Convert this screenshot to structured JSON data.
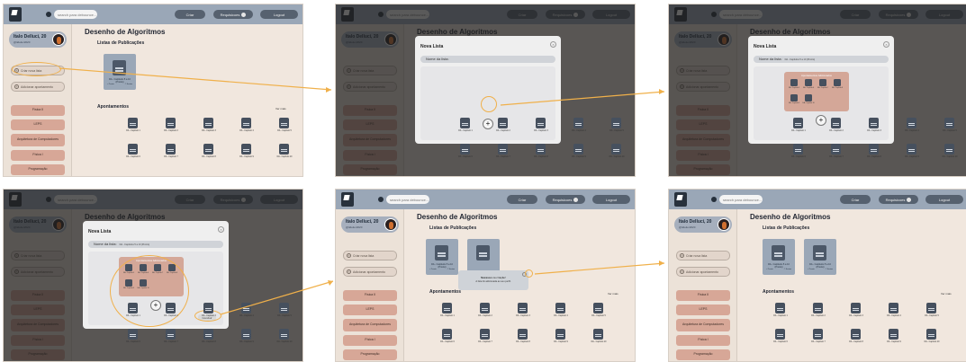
{
  "topbar": {
    "search_placeholder": "search para debounce...",
    "criar_label": "Criar",
    "requisicoes_label": "Requisicoes",
    "logout_label": "Logout"
  },
  "profile": {
    "name": "Italo Delluci, 20",
    "handle": "@itdeluc2020"
  },
  "sidebar": {
    "criar_lista": "Criar nova lista",
    "adicionar_apontamento": "Adicionar apontamento",
    "subjects": [
      "Física II",
      "LEPS",
      "Arquitetura de Computadores",
      "Física I",
      "Programação"
    ]
  },
  "main": {
    "title": "Desenho de Algoritmos",
    "listas_heading": "Listas de Publicações",
    "apontamentos_heading": "Apontamentos",
    "ver_mais": "Ver mais"
  },
  "publication": {
    "title": "DA - Capítulos 5 a 10 (Pronto)",
    "byline": "Delluci • Há um dia",
    "left_tag": "+ Pronto",
    "right_tag": "© Santos"
  },
  "files_row1": [
    "DA - Capítulo 1",
    "DA - Capítulo 2",
    "DA - Capítulo 3",
    "DA - Capítulo 4",
    "DA - Capítulo 5"
  ],
  "files_row2": [
    "DA - Capítulo 6",
    "DA - Capítulo 7",
    "DA - Capítulo 8",
    "DA - Capítulo 9",
    "DA - Capítulo 10"
  ],
  "modal": {
    "title": "Nova Lista",
    "name_label": "Nome da lista:",
    "name_value": "DA - Capítulos 5 a 10 (Pronto)",
    "add_symbol": "+",
    "close_symbol": "×",
    "ap_section": "Apontamentos Adicionados",
    "ap_items": [
      "DA - Capítulo 5",
      "DA - Capítulo 6",
      "DA - Capítulo 7",
      "DA - Capítulo 8",
      "DA - Capítulo 9",
      "DA - Capítulo 10"
    ],
    "concluir": "Concluir"
  },
  "toast": {
    "title_bold": "Sucesso",
    "title_rest": " na criação!",
    "message": "A lista foi adicionada ao seu perfil."
  },
  "colors": {
    "topbar": "#9aa7b7",
    "sidebar_bg": "#ece2d8",
    "subject_btn": "#d7a797",
    "highlight": "#f0b04a",
    "overlay": "#1e1e1e"
  }
}
